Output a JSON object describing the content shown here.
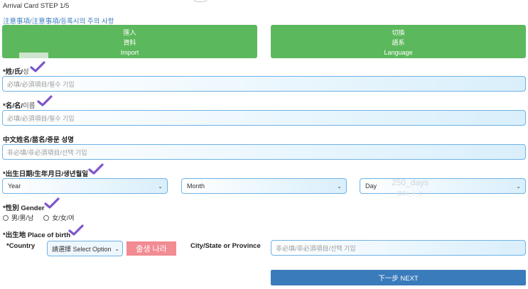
{
  "header": {
    "step_title": "Arrival Card STEP 1/5",
    "notice": "注意事項/注意事項/등록시의 주의 사항"
  },
  "buttons": {
    "import": [
      "匯入",
      "資料",
      "Import"
    ],
    "language": [
      "切換",
      "語系",
      "Language"
    ],
    "next": "下一步 NEXT"
  },
  "fields": {
    "surname": {
      "label": "*姓/氏/",
      "label_ko": "성",
      "placeholder": "必填/必須項目/필수 기입"
    },
    "given_name": {
      "label": "*名/名/",
      "label_ko": "이름",
      "placeholder": "必填/必須項目/필수 기입"
    },
    "chinese_name": {
      "label": "中文姓名/苗名/중문 성명",
      "placeholder": "非必填/非必須項目/선택 기입"
    },
    "birth_date": {
      "label": "*出生日期/生年月日/생년월일",
      "year": "Year",
      "month": "Month",
      "day": "Day"
    },
    "gender": {
      "label": "*性別 Gender",
      "options": [
        "男/男/남",
        "女/女/여"
      ]
    },
    "birth_place": {
      "label": "*出生地 Place of birth",
      "country_label": "*Country",
      "country_select": "請選擇 Select Option",
      "country_note": "출생 나라",
      "city_label": "City/State or Province",
      "city_placeholder": "非必填/非必須項目/선택 기입"
    }
  },
  "watermark": {
    "main": "250_days",
    "sub": "@3a_e_st"
  },
  "colors": {
    "green": "#5cb85c",
    "blue_button": "#3a7bbb",
    "checkmark": "#7d56c9",
    "input_border": "#6fb2e6",
    "pink_note": "#f28b92"
  }
}
